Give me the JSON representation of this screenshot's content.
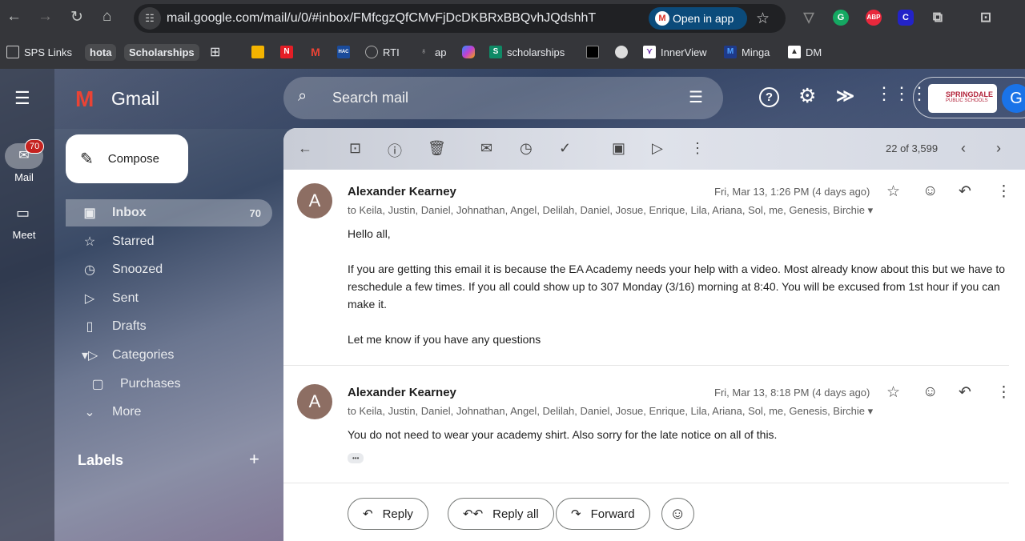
{
  "browser": {
    "url": "mail.google.com/mail/u/0/#inbox/FMfcgzQfCMvFjDcDKBRxBBQvhJQdshhT",
    "open_in_app": "Open in app",
    "extensions": [
      {
        "name": "ABP",
        "label": "ABP",
        "color": "#e8283c"
      },
      {
        "name": "C",
        "label": "C",
        "color": "#2323c8"
      },
      {
        "name": "Grammarly",
        "label": "G",
        "color": "#15a862"
      }
    ],
    "bookmarks": [
      "SPS Links",
      "hota",
      "Scholarships",
      "RTI",
      "ap",
      "scholarships",
      "InnerView",
      "Minga",
      "DM"
    ]
  },
  "gmail": {
    "brand": "Gmail",
    "search_placeholder": "Search mail",
    "org": {
      "line1": "SPRINGDALE",
      "line2": "PUBLIC SCHOOLS"
    },
    "avatar": "G",
    "rail": {
      "mail": "Mail",
      "mail_badge": "70",
      "meet": "Meet"
    },
    "compose": "Compose",
    "nav": [
      {
        "label": "Inbox",
        "count": "70"
      },
      {
        "label": "Starred"
      },
      {
        "label": "Snoozed"
      },
      {
        "label": "Sent"
      },
      {
        "label": "Drafts"
      },
      {
        "label": "Categories"
      },
      {
        "label": "Purchases"
      },
      {
        "label": "More"
      }
    ],
    "labels": "Labels"
  },
  "thread": {
    "counter": "22 of 3,599",
    "messages": [
      {
        "initial": "A",
        "from": "Alexander Kearney",
        "date": "Fri, Mar 13, 1:26 PM (4 days ago)",
        "to": "to Keila, Justin, Daniel, Johnathan, Angel, Delilah, Daniel, Josue, Enrique, Lila, Ariana, Sol, me, Genesis, Birchie",
        "body": [
          "Hello all,",
          "If you are getting this email it is because the EA Academy needs your help with a video. Most already know about this but we have to reschedule a few times. If you all could show up to 307 Monday (3/16) morning at 8:40. You will be excused from 1st hour if you can make it.",
          "Let me know if you have any questions"
        ]
      },
      {
        "initial": "A",
        "from": "Alexander Kearney",
        "date": "Fri, Mar 13, 8:18 PM (4 days ago)",
        "to": "to Keila, Justin, Daniel, Johnathan, Angel, Delilah, Daniel, Josue, Enrique, Lila, Ariana, Sol, me, Genesis, Birchie",
        "body": [
          "You do not need to wear your academy shirt. Also sorry for the late notice on all of this."
        ],
        "ellipsis": "•••"
      }
    ],
    "reply": "Reply",
    "reply_all": "Reply all",
    "forward": "Forward"
  }
}
